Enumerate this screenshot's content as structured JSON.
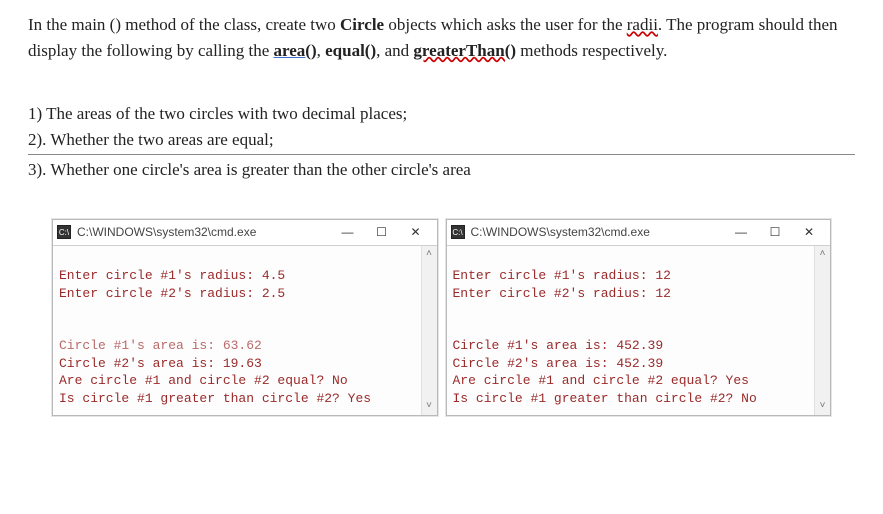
{
  "intro": {
    "part1": "In the main () method of the class, create two ",
    "circle": "Circle",
    "part2": " objects which asks the user for the ",
    "radii": "radii",
    "part3": ". The program should then display the following by calling the ",
    "area": "area()",
    "comma1": ", ",
    "equal": "equal()",
    "comma2": ", and ",
    "greaterThan": "greaterThan()",
    "part4": " methods respectively."
  },
  "list": {
    "item1": "1) The areas of the two circles with two decimal places;",
    "item2": "2). Whether the two areas are equal;",
    "item3": "3). Whether one circle's area is greater than the other circle's area"
  },
  "consoles": [
    {
      "title": "C:\\WINDOWS\\system32\\cmd.exe",
      "icon": "C:\\",
      "lines": {
        "l1": "Enter circle #1's radius: 4.5",
        "l2": "Enter circle #2's radius: 2.5",
        "blank": "",
        "l3": "Circle #1's area is: 63.62",
        "l4": "Circle #2's area is: 19.63",
        "l5": "Are circle #1 and circle #2 equal? No",
        "l6": "Is circle #1 greater than circle #2? Yes"
      }
    },
    {
      "title": "C:\\WINDOWS\\system32\\cmd.exe",
      "icon": "C:\\",
      "lines": {
        "l1": "Enter circle #1's radius: 12",
        "l2": "Enter circle #2's radius: 12",
        "blank": "",
        "l3": "Circle #1's area is: 452.39",
        "l4": "Circle #2's area is: 452.39",
        "l5": "Are circle #1 and circle #2 equal? Yes",
        "l6": "Is circle #1 greater than circle #2? No"
      }
    }
  ],
  "windowControls": {
    "min": "—",
    "max": "☐",
    "close": "✕"
  },
  "scroll": {
    "up": "˄",
    "down": "˅"
  }
}
